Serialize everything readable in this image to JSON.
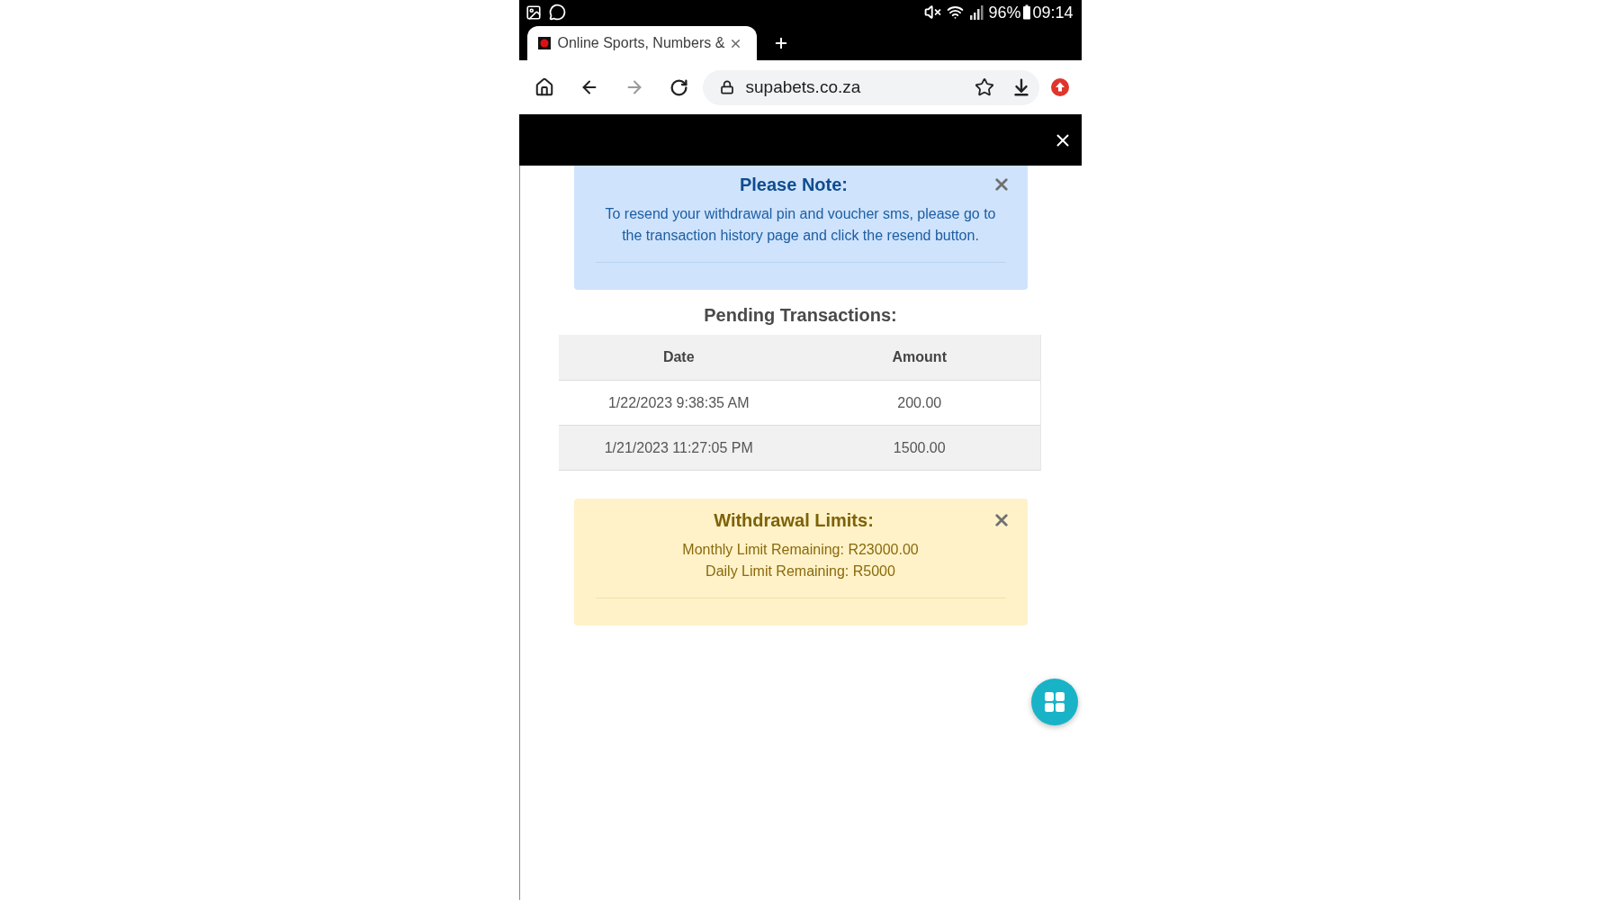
{
  "status_bar": {
    "battery": "96%",
    "time": "09:14"
  },
  "browser": {
    "tabs": [
      {
        "title": "Online Sports, Numbers &",
        "selected": true
      }
    ],
    "url": "supabets.co.za"
  },
  "note": {
    "kind": "info",
    "title": "Please Note:",
    "lines": [
      "To resend your withdrawal pin and voucher sms, please go to the transaction history page and click the resend button."
    ]
  },
  "pending_transactions": {
    "title": "Pending Transactions:",
    "columns": [
      "Date",
      "Amount"
    ],
    "rows": [
      [
        "1/22/2023 9:38:35 AM",
        "200.00"
      ],
      [
        "1/21/2023 11:27:05 PM",
        "1500.00"
      ]
    ]
  },
  "withdrawal_limits": {
    "kind": "warning",
    "title": "Withdrawal Limits:",
    "lines": [
      "Monthly Limit Remaining: R23000.00",
      "Daily Limit Remaining: R5000"
    ]
  }
}
